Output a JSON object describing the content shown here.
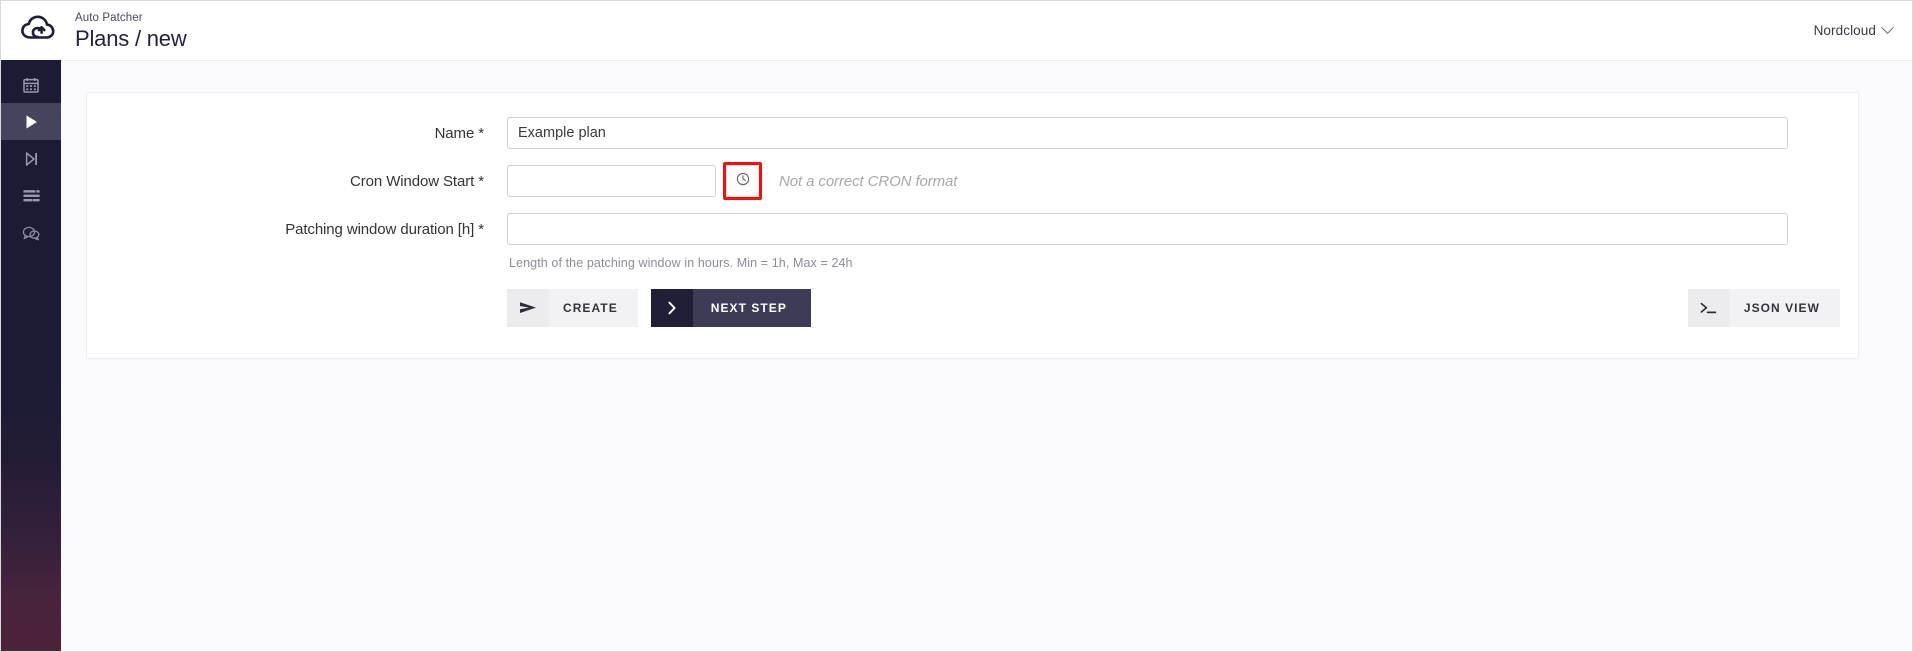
{
  "window": {
    "background": "#fafafc",
    "accent_dark": "#1b1b33",
    "highlight_color": "#fb0d0d"
  },
  "header": {
    "logo_icon": "nordcloud-cloud-logo",
    "subtitle": "Auto Patcher",
    "title": "Plans / new",
    "user_menu": {
      "label": "Nordcloud",
      "chevron_icon": "chevron-down-icon"
    }
  },
  "sidebar": {
    "items": [
      {
        "icon": "calendar-icon",
        "active": false
      },
      {
        "icon": "play-icon",
        "active": true
      },
      {
        "icon": "skip-next-icon",
        "active": false
      },
      {
        "icon": "list-icon",
        "active": false
      },
      {
        "icon": "chat-bubble-icon",
        "active": false
      }
    ]
  },
  "form": {
    "fields": [
      {
        "label": "Name *",
        "value": "Example plan",
        "placeholder": ""
      },
      {
        "label": "Cron Window Start *",
        "value": "",
        "placeholder": ""
      },
      {
        "label": "Patching window duration [h] *",
        "value": "",
        "placeholder": ""
      }
    ],
    "cron_picker": {
      "icon": "clock-icon",
      "highlighted": true,
      "error_message": "Not a correct CRON format"
    },
    "helper_text": "Length of the patching window in hours. Min = 1h, Max = 24h"
  },
  "actions": {
    "create": {
      "label": "CREATE",
      "icon": "send-icon"
    },
    "next_step": {
      "label": "NEXT STEP",
      "icon": "chevron-right-icon"
    },
    "json_view": {
      "label": "JSON VIEW",
      "icon": "terminal-icon"
    }
  }
}
